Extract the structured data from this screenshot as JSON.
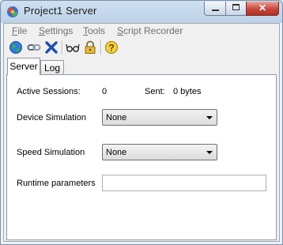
{
  "window": {
    "title": "Project1 Server"
  },
  "menu": {
    "file": {
      "accel": "F",
      "rest": "ile"
    },
    "settings": {
      "accel": "S",
      "rest": "ettings"
    },
    "tools": {
      "accel": "T",
      "rest": "ools"
    },
    "script_recorder": {
      "accel": "S",
      "rest": "cript Recorder"
    }
  },
  "toolbar": {
    "icons": [
      "globe-icon",
      "link-icon",
      "close-x-icon",
      "glasses-icon",
      "lock-icon",
      "help-icon"
    ]
  },
  "tabs": [
    {
      "label": "Server",
      "active": true
    },
    {
      "label": "Log",
      "active": false
    }
  ],
  "server": {
    "active_sessions_label": "Active Sessions:",
    "active_sessions_value": "0",
    "sent_label": "Sent:",
    "sent_value": "0 bytes",
    "device_sim_label": "Device Simulation",
    "device_sim_value": "None",
    "speed_sim_label": "Speed Simulation",
    "speed_sim_value": "None",
    "runtime_label": "Runtime parameters",
    "runtime_value": ""
  },
  "colors": {
    "close_button": "#c7483a",
    "titlebar": "#cfe0f1",
    "menu_text": "#6f6f6f"
  }
}
